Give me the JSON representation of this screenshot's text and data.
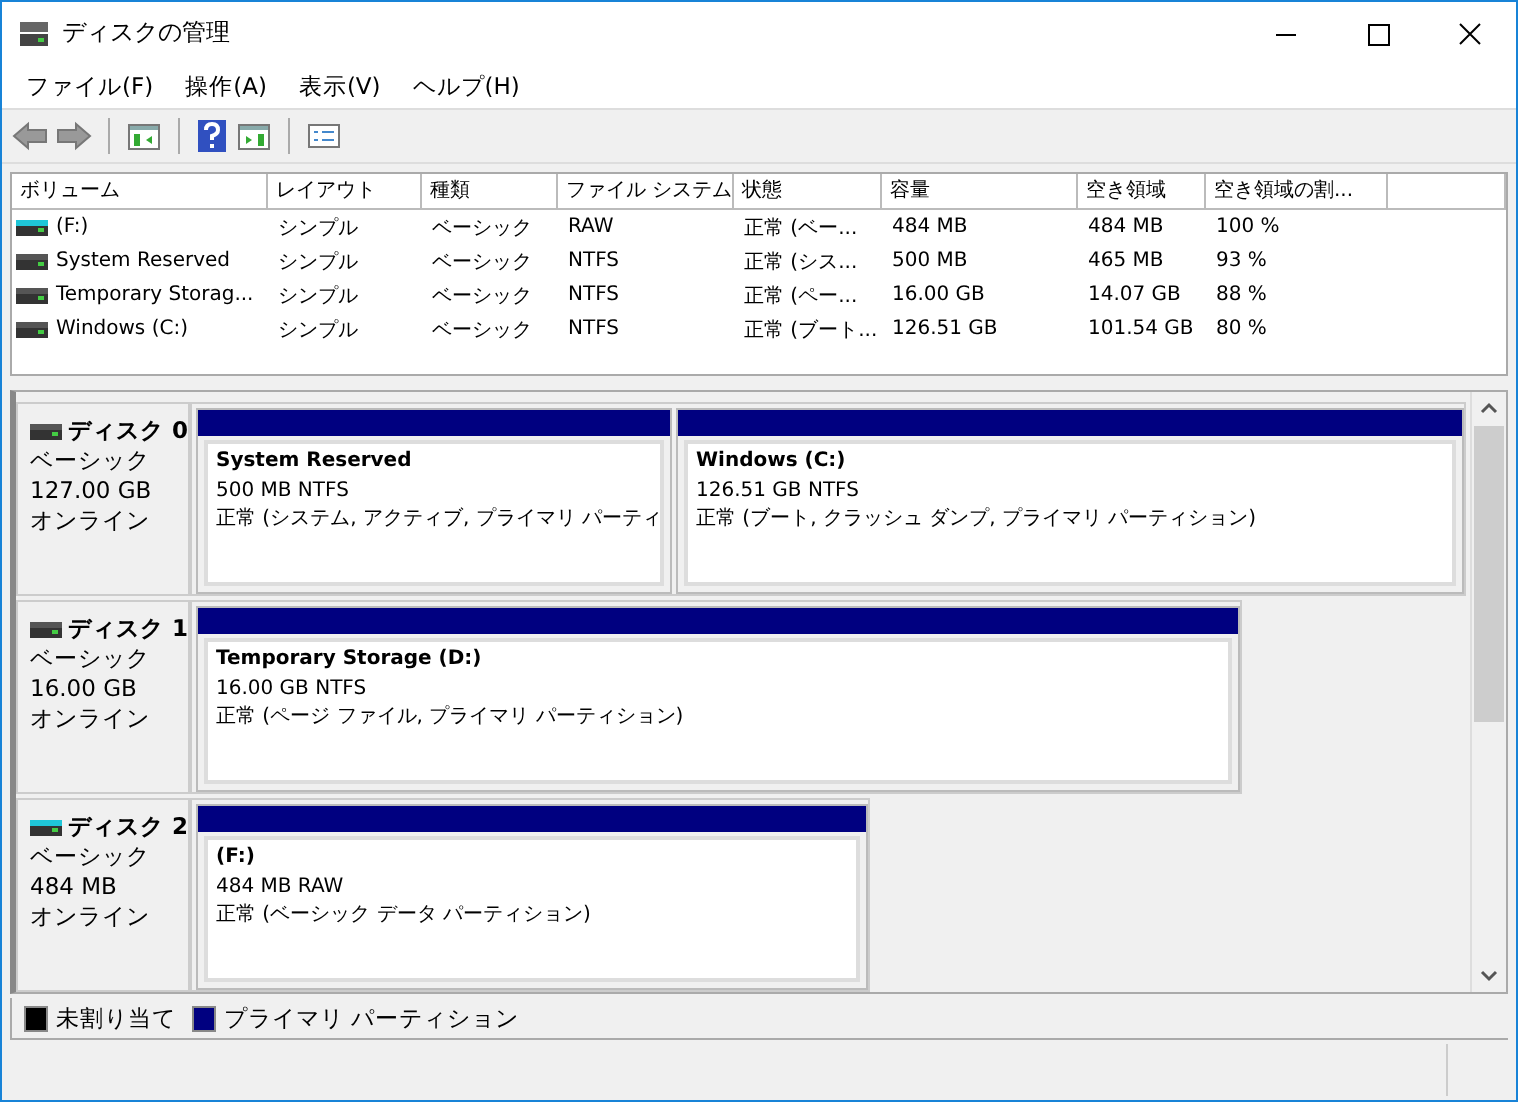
{
  "window": {
    "title": "ディスクの管理"
  },
  "menu": [
    "ファイル(F)",
    "操作(A)",
    "表示(V)",
    "ヘルプ(H)"
  ],
  "volume_list": {
    "columns": [
      "ボリューム",
      "レイアウト",
      "種類",
      "ファイル システム",
      "状態",
      "容量",
      "空き領域",
      "空き領域の割..."
    ],
    "rows": [
      {
        "kind": "removable",
        "cells": [
          "(F:)",
          "シンプル",
          "ベーシック",
          "RAW",
          "正常 (ベー...",
          "484 MB",
          "484 MB",
          "100 %"
        ]
      },
      {
        "kind": "fixed",
        "cells": [
          "System Reserved",
          "シンプル",
          "ベーシック",
          "NTFS",
          "正常 (シス...",
          "500 MB",
          "465 MB",
          "93 %"
        ]
      },
      {
        "kind": "fixed",
        "cells": [
          "Temporary Storag...",
          "シンプル",
          "ベーシック",
          "NTFS",
          "正常 (ペー...",
          "16.00 GB",
          "14.07 GB",
          "88 %"
        ]
      },
      {
        "kind": "fixed",
        "cells": [
          "Windows (C:)",
          "シンプル",
          "ベーシック",
          "NTFS",
          "正常 (ブート...",
          "126.51 GB",
          "101.54 GB",
          "80 %"
        ]
      }
    ]
  },
  "disks": [
    {
      "name": "ディスク 0",
      "kind": "fixed",
      "type": "ベーシック",
      "size": "127.00 GB",
      "status": "オンライン",
      "partitions": [
        {
          "name": "System Reserved",
          "info": "500 MB NTFS",
          "status": "正常 (システム, アクティブ, プライマリ パーティ"
        },
        {
          "name": "Windows  (C:)",
          "info": "126.51 GB NTFS",
          "status": "正常 (ブート, クラッシュ ダンプ, プライマリ パーティション)"
        }
      ]
    },
    {
      "name": "ディスク 1",
      "kind": "fixed",
      "type": "ベーシック",
      "size": "16.00 GB",
      "status": "オンライン",
      "partitions": [
        {
          "name": "Temporary Storage  (D:)",
          "info": "16.00 GB NTFS",
          "status": "正常 (ページ ファイル, プライマリ パーティション)"
        }
      ]
    },
    {
      "name": "ディスク 2",
      "kind": "removable",
      "type": "ベーシック",
      "size": "484 MB",
      "status": "オンライン",
      "partitions": [
        {
          "name": "(F:)",
          "info": "484 MB RAW",
          "status": "正常 (ベーシック データ パーティション)"
        }
      ]
    }
  ],
  "legend": [
    {
      "label": "未割り当て",
      "color": "#000000"
    },
    {
      "label": "プライマリ パーティション",
      "color": "#000080"
    }
  ]
}
